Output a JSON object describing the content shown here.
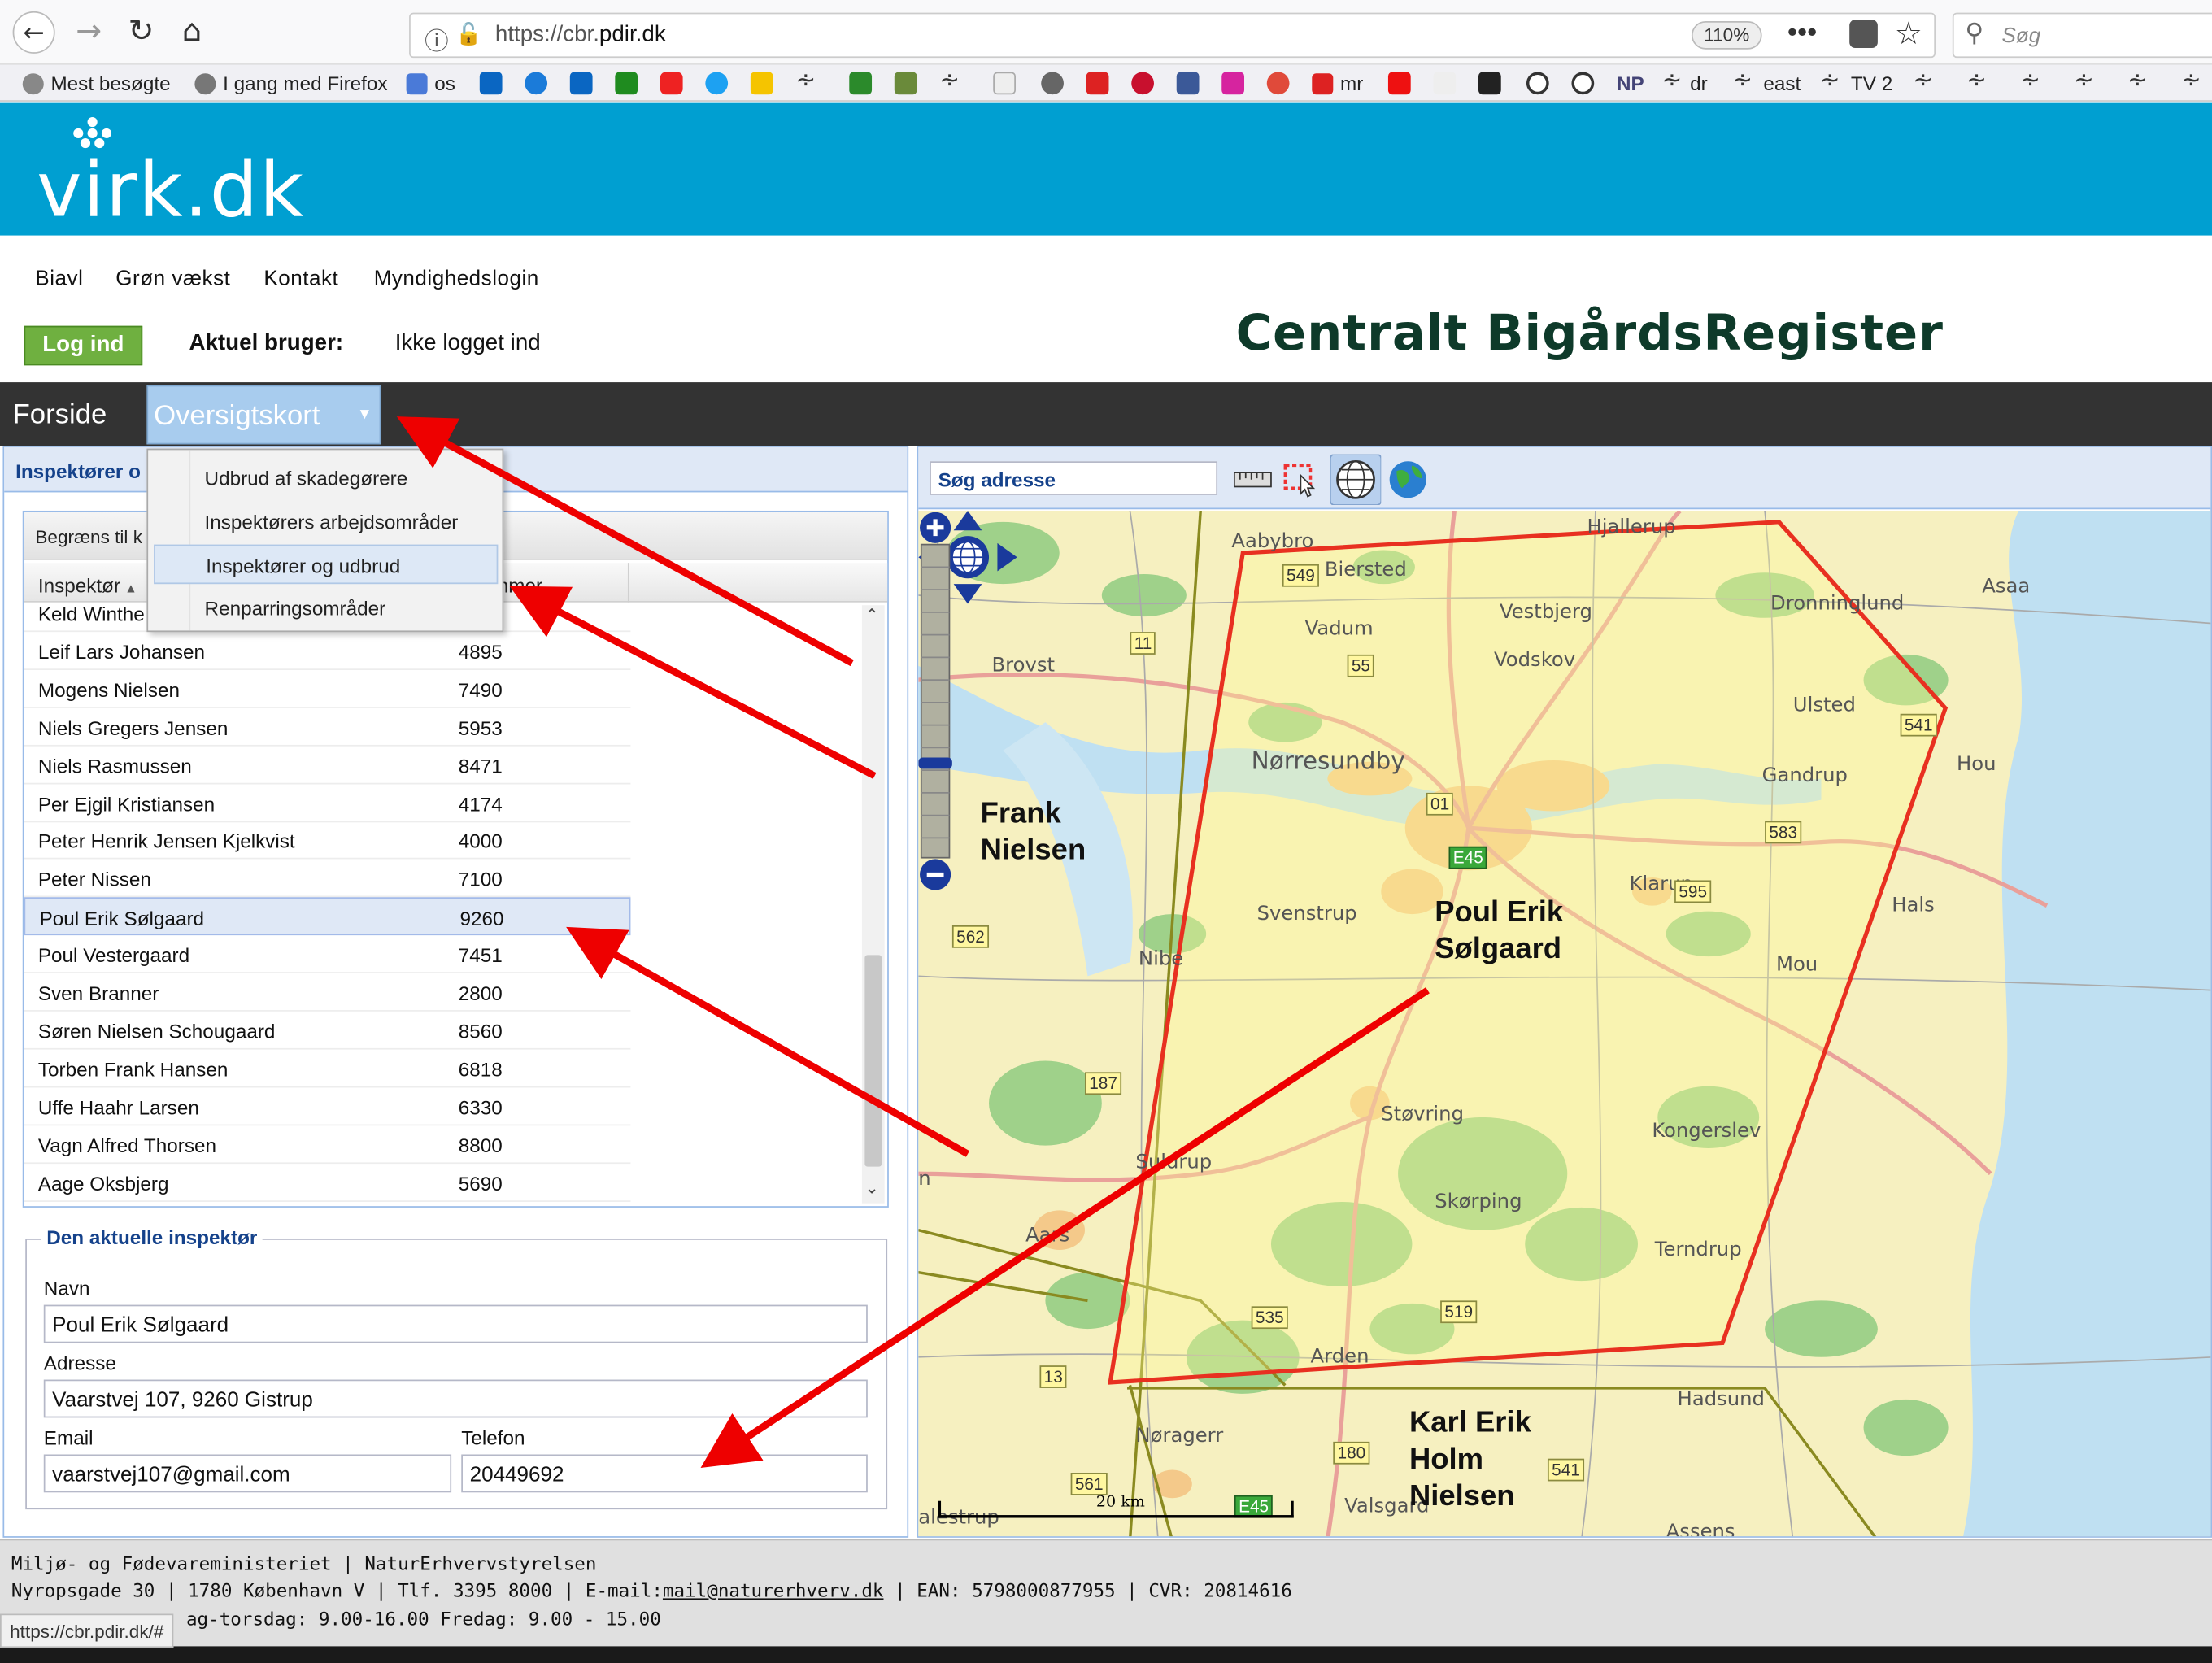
{
  "browser": {
    "url_prefix": "https://cbr.",
    "url_domain": "pdir.dk",
    "zoom": "110%",
    "search_placeholder": "Søg",
    "status_url": "https://cbr.pdir.dk/#",
    "bookmarks": {
      "most_visited": "Mest besøgte",
      "getting_started": "I gang med Firefox",
      "os": "os",
      "mr": "mr",
      "np": "NP",
      "dr": "dr",
      "east": "east",
      "tv2": "TV 2"
    }
  },
  "site": {
    "logo": "virk.dk",
    "nav": [
      "Biavl",
      "Grøn vækst",
      "Kontakt",
      "Myndighedslogin"
    ],
    "login_label": "Log ind",
    "current_user_label": "Aktuel bruger:",
    "current_user_value": "Ikke logget ind",
    "title": "Centralt BigårdsRegister"
  },
  "menu": {
    "forside": "Forside",
    "oversigtskort": "Oversigtskort",
    "dropdown": [
      "Udbrud af skadegørere",
      "Inspektørers arbejdsområder",
      "Inspektører og udbrud",
      "Renparringsområder"
    ],
    "active_index": 2
  },
  "left_panel": {
    "title": "Inspektører o",
    "filter_label": "Begræns til k",
    "col_inspector": "Inspektør",
    "col_postal": "ummer",
    "rows": [
      {
        "name": "Keld Winthe",
        "postal": ""
      },
      {
        "name": "Leif Lars Johansen",
        "postal": "4895"
      },
      {
        "name": "Mogens Nielsen",
        "postal": "7490"
      },
      {
        "name": "Niels Gregers Jensen",
        "postal": "5953"
      },
      {
        "name": "Niels Rasmussen",
        "postal": "8471"
      },
      {
        "name": "Per Ejgil Kristiansen",
        "postal": "4174"
      },
      {
        "name": "Peter Henrik Jensen Kjelkvist",
        "postal": "4000"
      },
      {
        "name": "Peter Nissen",
        "postal": "7100"
      },
      {
        "name": "Poul Erik Sølgaard",
        "postal": "9260"
      },
      {
        "name": "Poul Vestergaard",
        "postal": "7451"
      },
      {
        "name": "Sven Branner",
        "postal": "2800"
      },
      {
        "name": "Søren Nielsen Schougaard",
        "postal": "8560"
      },
      {
        "name": "Torben Frank Hansen",
        "postal": "6818"
      },
      {
        "name": "Uffe Haahr Larsen",
        "postal": "6330"
      },
      {
        "name": "Vagn Alfred Thorsen",
        "postal": "8800"
      },
      {
        "name": "Aage Oksbjerg",
        "postal": "5690"
      }
    ],
    "selected_index": 8
  },
  "inspector": {
    "legend": "Den aktuelle inspektør",
    "name_label": "Navn",
    "name": "Poul Erik Sølgaard",
    "address_label": "Adresse",
    "address": "Vaarstvej 107, 9260 Gistrup",
    "email_label": "Email",
    "email": "vaarstvej107@gmail.com",
    "phone_label": "Telefon",
    "phone": "20449692"
  },
  "map": {
    "search_placeholder": "Søg adresse",
    "scale_label": "20 km",
    "places": [
      "Aabybro",
      "Biersted",
      "Hjallerup",
      "Asaa",
      "Vadum",
      "Vestbjerg",
      "Dronninglund",
      "Brovst",
      "Vodskov",
      "Ulsted",
      "Hou",
      "Nørresundby",
      "Gandrup",
      "Klarup",
      "Svenstrup",
      "Hals",
      "Nibe",
      "Mou",
      "Støvring",
      "Kongerslev",
      "Suldrup",
      "Skørping",
      "Terndrup",
      "Aars",
      "Arden",
      "Hadsund",
      "Nøragerr",
      "Valsgard",
      "Assens",
      "alestrup",
      "n"
    ],
    "roads": [
      "549",
      "55",
      "11",
      "541",
      "01",
      "E45",
      "583",
      "595",
      "562",
      "187",
      "535",
      "519",
      "13",
      "180",
      "561",
      "541",
      "E45"
    ],
    "area_names": {
      "frank": "Frank\nNielsen",
      "poul": "Poul Erik\nSølgaard",
      "karl": "Karl Erik\nHolm\nNielsen"
    }
  },
  "footer": {
    "line1": "Miljø- og Fødevareministeriet | NaturErhvervstyrelsen",
    "line2_prefix": "Nyropsgade 30 | 1780 København V | Tlf. 3395 8000 | E-mail:",
    "line2_email": "mail@naturerhverv.dk",
    "line2_suffix": " | EAN: 5798000877955 | CVR: 20814616",
    "line3": "ag-torsdag: 9.00-16.00 Fredag: 9.00 - 15.00"
  },
  "colors": {
    "header_blue": "#009fd1",
    "menu_dark": "#333333",
    "login_green": "#6fb040",
    "polygon_red": "#e83020",
    "arrow_red": "#ee0000"
  }
}
